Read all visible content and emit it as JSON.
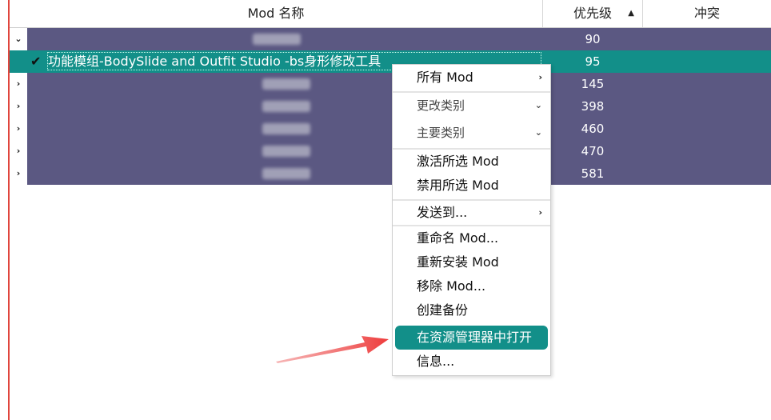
{
  "header": {
    "col_name": "Mod 名称",
    "col_priority": "优先级",
    "col_conflict": "冲突",
    "sort_icon": "sort-up-icon"
  },
  "rows": [
    {
      "priority": "90",
      "expanded": true
    },
    {
      "name": "功能模组-BodySlide and Outfit Studio -bs身形修改工具",
      "priority": "95",
      "selected": true,
      "checked": true
    },
    {
      "priority": "145"
    },
    {
      "priority": "398"
    },
    {
      "priority": "460"
    },
    {
      "priority": "470"
    },
    {
      "priority": "581"
    }
  ],
  "menu": {
    "all_mods": "所有 Mod",
    "change_category": "更改类别",
    "primary_category": "主要类别",
    "enable_selected": "激活所选 Mod",
    "disable_selected": "禁用所选 Mod",
    "send_to": "发送到...",
    "rename": "重命名 Mod...",
    "reinstall": "重新安装 Mod",
    "remove": "移除 Mod...",
    "create_backup": "创建备份",
    "open_in_explorer": "在资源管理器中打开",
    "info": "信息..."
  },
  "colors": {
    "row_bg": "#5b5882",
    "selected_bg": "#128f89",
    "accent_red": "#e0453d"
  }
}
